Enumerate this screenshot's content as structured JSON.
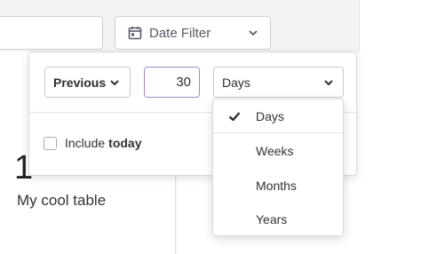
{
  "date_filter": {
    "label": "Date Filter",
    "icon": "calendar-icon"
  },
  "card": {
    "big_number": "1",
    "big_number_tail": "",
    "caption": "My cool table"
  },
  "popover": {
    "period_select": {
      "value": "Previous"
    },
    "count_input": {
      "value": "30"
    },
    "unit_select": {
      "value": "Days"
    },
    "include_today": {
      "label": "Include",
      "label_bold": "today",
      "checked": false
    }
  },
  "unit_dropdown": {
    "options": [
      "Days",
      "Weeks",
      "Months",
      "Years"
    ],
    "selected": "Days"
  },
  "colors": {
    "accent_border": "#a487c9"
  }
}
